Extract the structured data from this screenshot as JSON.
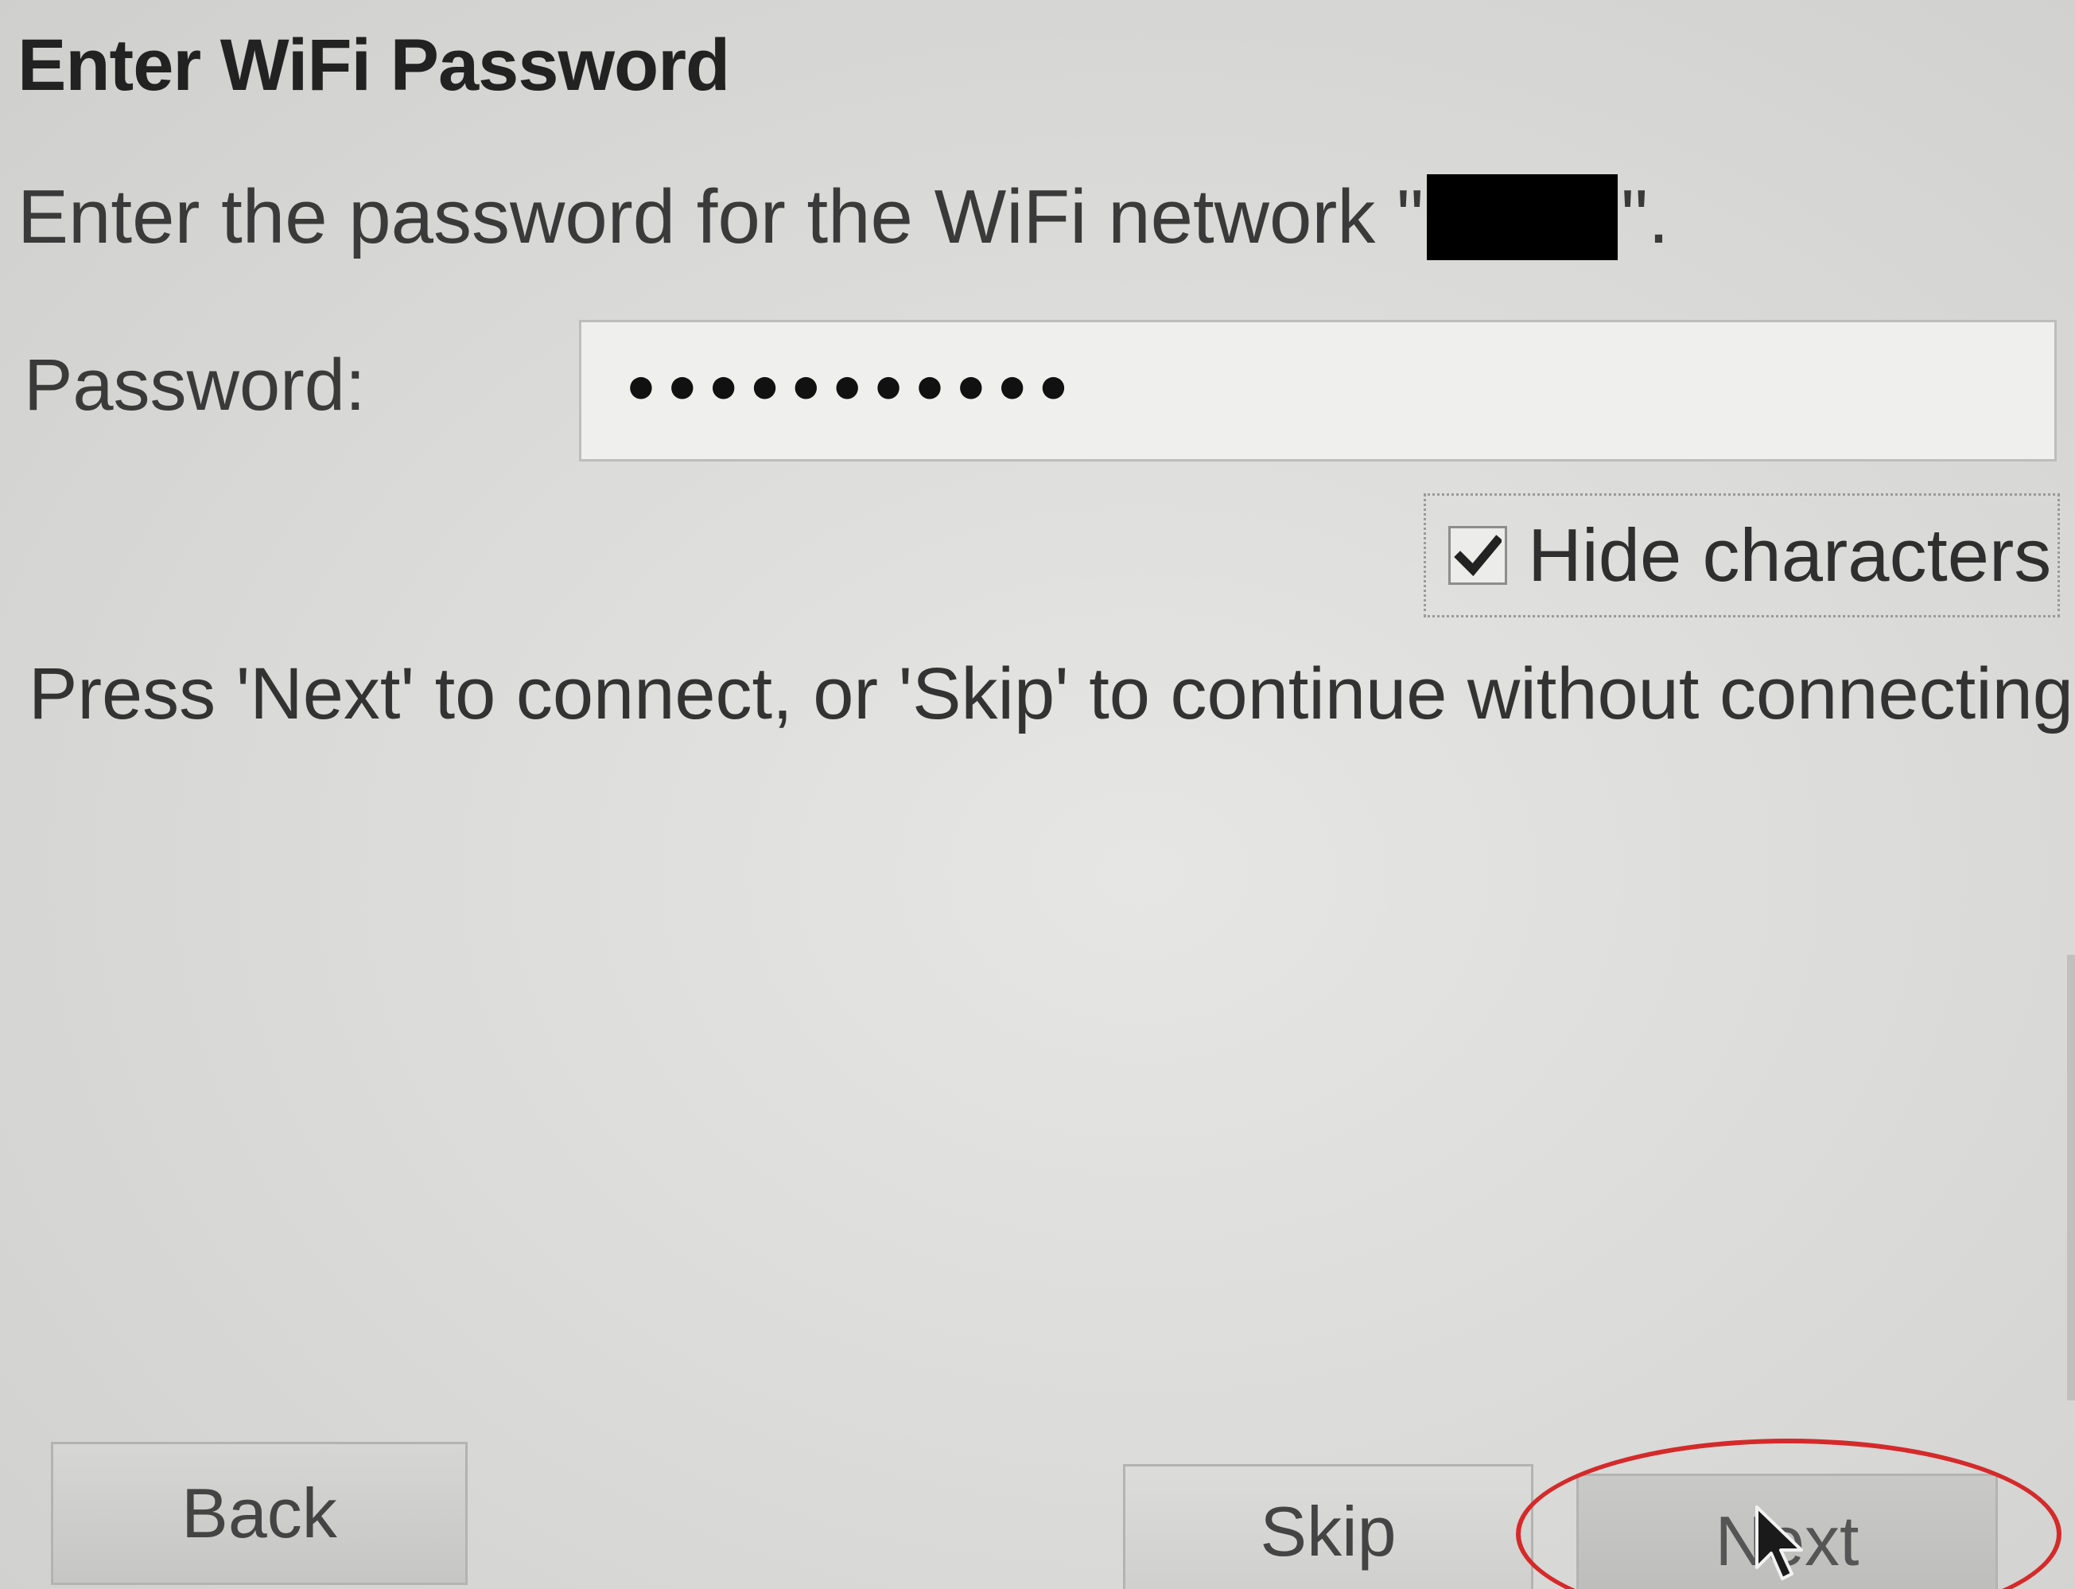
{
  "dialog": {
    "title": "Enter WiFi Password",
    "intro_prefix": "Enter the password for the WiFi network \"",
    "intro_suffix": "\"."
  },
  "password": {
    "label": "Password:",
    "value": "•••••••••••"
  },
  "hide_characters": {
    "label": "Hide characters",
    "checked": true
  },
  "hint": "Press 'Next' to connect, or 'Skip' to continue without connecting.",
  "buttons": {
    "back": "Back",
    "skip": "Skip",
    "next": "Next"
  },
  "colors": {
    "annotation_ring": "#d42a2a"
  },
  "icons": {
    "checkbox": "checkmark-icon",
    "cursor": "mouse-pointer-icon"
  }
}
